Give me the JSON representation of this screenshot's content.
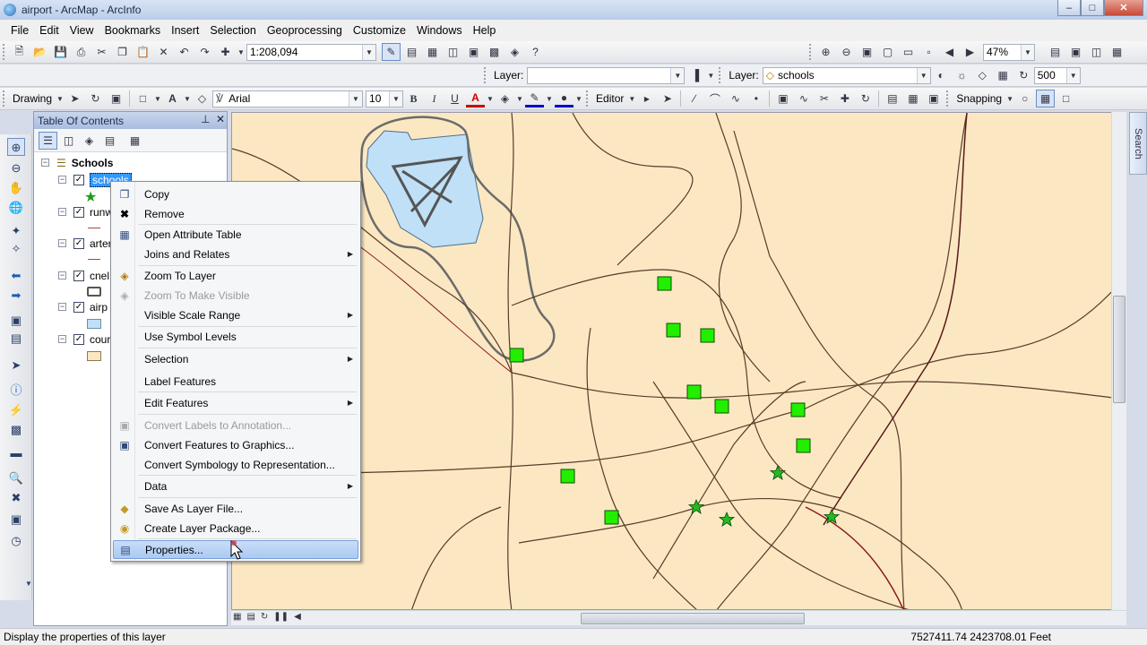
{
  "window": {
    "title": "airport - ArcMap - ArcInfo"
  },
  "menubar": {
    "items": [
      "File",
      "Edit",
      "View",
      "Bookmarks",
      "Insert",
      "Selection",
      "Geoprocessing",
      "Customize",
      "Windows",
      "Help"
    ]
  },
  "standard_toolbar": {
    "scale_value": "1:208,094",
    "zoom_percent": "47%"
  },
  "layer_toolbar": {
    "layer_label": "Layer:",
    "layer_value": "",
    "layer_label_2": "Layer:",
    "layer_value_2": "schools",
    "distance_value": "500"
  },
  "draw_toolbar": {
    "drawing_label": "Drawing",
    "font_name": "Arial",
    "font_size": "10",
    "bold": "B",
    "italic": "I",
    "underline": "U",
    "editor_label": "Editor",
    "snapping_label": "Snapping"
  },
  "toc": {
    "title": "Table Of Contents",
    "root": "Schools",
    "layers": [
      {
        "name": "schools",
        "selected": true
      },
      {
        "name": "runw"
      },
      {
        "name": "arter"
      },
      {
        "name": "cnel"
      },
      {
        "name": "airp"
      },
      {
        "name": "cour"
      }
    ]
  },
  "context_menu": {
    "items": [
      {
        "label": "Copy",
        "icon": "copy-icon"
      },
      {
        "label": "Remove",
        "icon": "remove-icon"
      },
      {
        "label": "Open Attribute Table",
        "icon": "table-icon"
      },
      {
        "label": "Joins and Relates",
        "submenu": true
      },
      {
        "label": "Zoom To Layer",
        "icon": "zoom-to-layer-icon"
      },
      {
        "label": "Zoom To Make Visible",
        "disabled": true
      },
      {
        "label": "Visible Scale Range",
        "submenu": true
      },
      {
        "label": "Use Symbol Levels"
      },
      {
        "label": "Selection",
        "submenu": true
      },
      {
        "label": "Label Features"
      },
      {
        "label": "Edit Features",
        "submenu": true
      },
      {
        "label": "Convert Labels to Annotation...",
        "disabled": true
      },
      {
        "label": "Convert Features to Graphics...",
        "icon": "convert-graphics-icon"
      },
      {
        "label": "Convert Symbology to Representation..."
      },
      {
        "label": "Data",
        "submenu": true
      },
      {
        "label": "Save As Layer File...",
        "icon": "layer-file-icon"
      },
      {
        "label": "Create Layer Package...",
        "icon": "layer-package-icon"
      },
      {
        "label": "Properties...",
        "icon": "properties-icon",
        "highlighted": true
      }
    ]
  },
  "search_tab": {
    "label": "Search"
  },
  "statusbar": {
    "message": "Display the properties of this layer",
    "coordinates": "7527411.74  2423708.01 Feet"
  },
  "colors": {
    "map_background": "#fbe8c2",
    "school_fill": "#22ee00",
    "airport_fill": "#bfe0f7",
    "menu_highlight": "#bcd5f5"
  }
}
